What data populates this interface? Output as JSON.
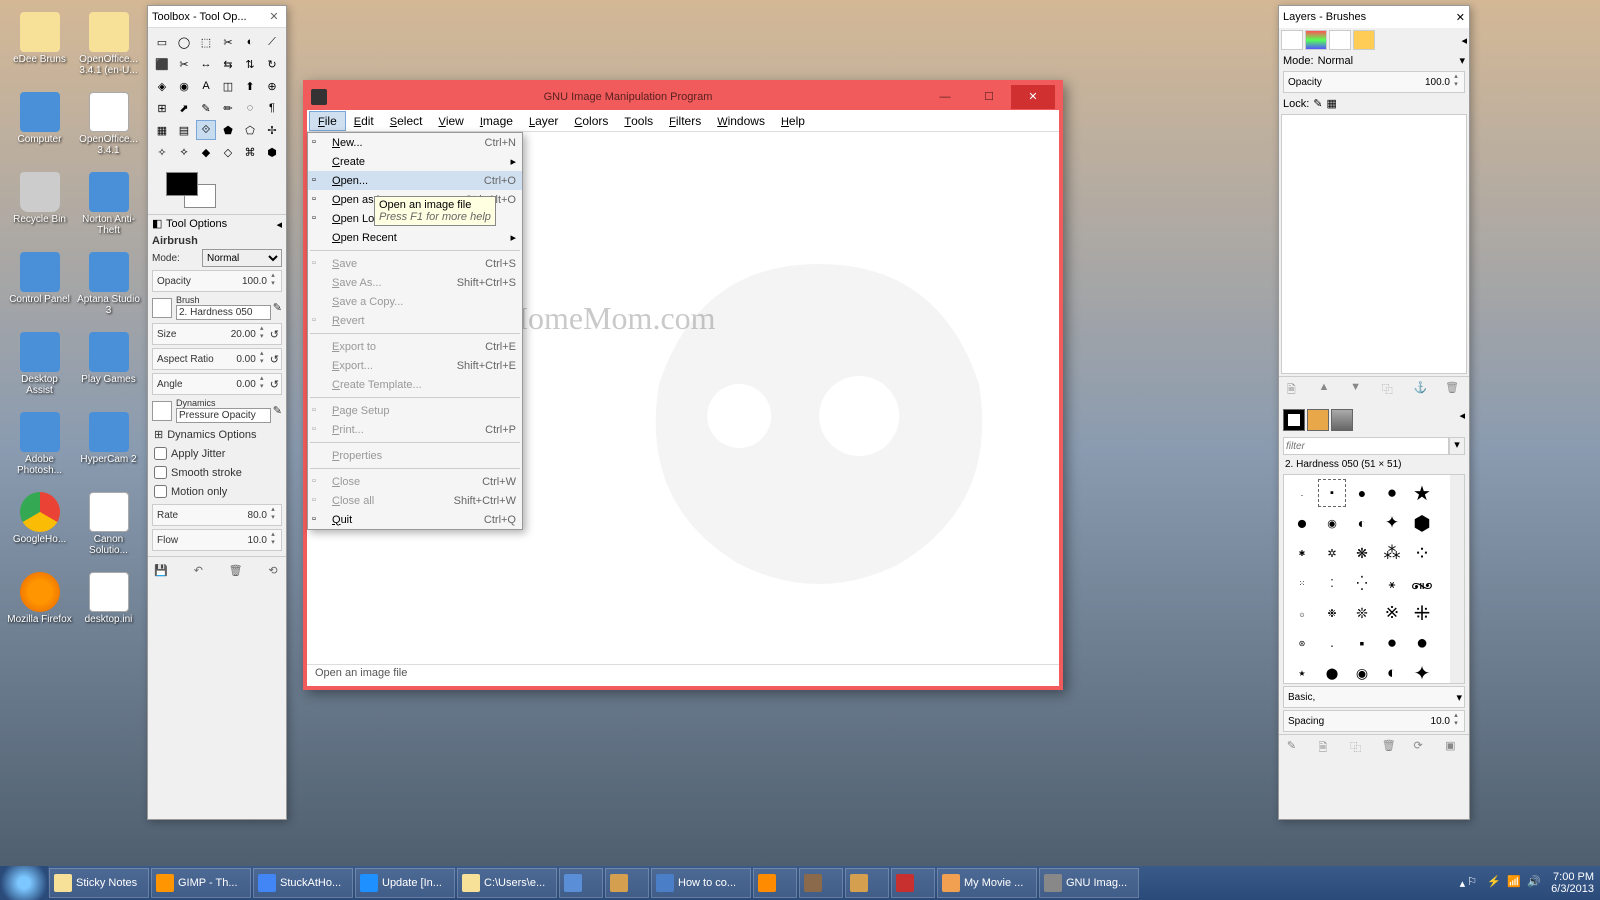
{
  "desktop_icons": [
    {
      "label": "eDee Bruns",
      "type": "folder"
    },
    {
      "label": "OpenOffice... 3.4.1 (en-U...",
      "type": "folder"
    },
    {
      "label": "Computer",
      "type": "app"
    },
    {
      "label": "OpenOffice... 3.4.1",
      "type": "doc"
    },
    {
      "label": "Recycle Bin",
      "type": "bin"
    },
    {
      "label": "Norton Anti-Theft",
      "type": "app"
    },
    {
      "label": "Control Panel",
      "type": "app"
    },
    {
      "label": "Aptana Studio 3",
      "type": "app"
    },
    {
      "label": "Desktop Assist",
      "type": "app"
    },
    {
      "label": "Play Games",
      "type": "app"
    },
    {
      "label": "Adobe Photosh...",
      "type": "app"
    },
    {
      "label": "HyperCam 2",
      "type": "app"
    },
    {
      "label": "GoogleHo...",
      "type": "chrome"
    },
    {
      "label": "Canon Solutio...",
      "type": "doc"
    },
    {
      "label": "Mozilla Firefox",
      "type": "ff"
    },
    {
      "label": "desktop.ini",
      "type": "doc"
    }
  ],
  "toolbox": {
    "title": "Toolbox - Tool Op...",
    "tool_options_label": "Tool Options",
    "tool_name": "Airbrush",
    "mode_label": "Mode:",
    "mode_value": "Normal",
    "opacity_label": "Opacity",
    "opacity_value": "100.0",
    "brush_label": "Brush",
    "brush_value": "2. Hardness 050",
    "size_label": "Size",
    "size_value": "20.00",
    "aspect_label": "Aspect Ratio",
    "aspect_value": "0.00",
    "angle_label": "Angle",
    "angle_value": "0.00",
    "dynamics_label": "Dynamics",
    "dynamics_value": "Pressure Opacity",
    "dyn_options": "Dynamics Options",
    "jitter": "Apply Jitter",
    "smooth": "Smooth stroke",
    "motion": "Motion only",
    "rate_label": "Rate",
    "rate_value": "80.0",
    "flow_label": "Flow",
    "flow_value": "10.0"
  },
  "gimp": {
    "title": "GNU Image Manipulation Program",
    "menus": [
      "File",
      "Edit",
      "Select",
      "View",
      "Image",
      "Layer",
      "Colors",
      "Tools",
      "Filters",
      "Windows",
      "Help"
    ],
    "statusbar": "Open an image file",
    "file_menu": [
      {
        "label": "New...",
        "key": "Ctrl+N",
        "icon": "doc"
      },
      {
        "label": "Create",
        "sub": true
      },
      {
        "label": "Open...",
        "key": "Ctrl+O",
        "icon": "folder",
        "hover": true
      },
      {
        "label": "Open as Layers...",
        "key": "Ctrl+Alt+O",
        "icon": "layers"
      },
      {
        "label": "Open Location...",
        "icon": "globe"
      },
      {
        "label": "Open Recent",
        "sub": true
      },
      {
        "sep": true
      },
      {
        "label": "Save",
        "key": "Ctrl+S",
        "icon": "save",
        "dis": true
      },
      {
        "label": "Save As...",
        "key": "Shift+Ctrl+S",
        "dis": true
      },
      {
        "label": "Save a Copy...",
        "dis": true
      },
      {
        "label": "Revert",
        "icon": "revert",
        "dis": true
      },
      {
        "sep": true
      },
      {
        "label": "Export to",
        "key": "Ctrl+E",
        "dis": true
      },
      {
        "label": "Export...",
        "key": "Shift+Ctrl+E",
        "dis": true
      },
      {
        "label": "Create Template...",
        "dis": true
      },
      {
        "sep": true
      },
      {
        "label": "Page Setup",
        "icon": "page",
        "dis": true
      },
      {
        "label": "Print...",
        "key": "Ctrl+P",
        "icon": "print",
        "dis": true
      },
      {
        "sep": true
      },
      {
        "label": "Properties",
        "dis": true
      },
      {
        "sep": true
      },
      {
        "label": "Close",
        "key": "Ctrl+W",
        "icon": "close",
        "dis": true
      },
      {
        "label": "Close all",
        "key": "Shift+Ctrl+W",
        "icon": "close",
        "dis": true
      },
      {
        "label": "Quit",
        "key": "Ctrl+Q",
        "icon": "quit"
      }
    ],
    "tooltip_title": "Open an image file",
    "tooltip_help": "Press F1 for more help"
  },
  "layers": {
    "title": "Layers - Brushes",
    "mode_label": "Mode:",
    "mode_value": "Normal",
    "opacity_label": "Opacity",
    "opacity_value": "100.0",
    "lock_label": "Lock:",
    "filter_placeholder": "filter",
    "brush_label": "2. Hardness 050 (51 × 51)",
    "preset_label": "Basic,",
    "spacing_label": "Spacing",
    "spacing_value": "10.0"
  },
  "taskbar": {
    "buttons": [
      {
        "label": "Sticky Notes",
        "color": "#f7e199"
      },
      {
        "label": "GIMP - Th...",
        "color": "#ff9500"
      },
      {
        "label": "StuckAtHo...",
        "color": "#4285f4"
      },
      {
        "label": "Update [In...",
        "color": "#1e90ff"
      },
      {
        "label": "C:\\Users\\e...",
        "color": "#f7e199"
      },
      {
        "label": "",
        "color": "#5a8fd8"
      },
      {
        "label": "",
        "color": "#d4a050"
      },
      {
        "label": "How to co...",
        "color": "#4a7fc8"
      },
      {
        "label": "",
        "color": "#ff8c00"
      },
      {
        "label": "",
        "color": "#8a6a4a"
      },
      {
        "label": "",
        "color": "#d4a050"
      },
      {
        "label": "",
        "color": "#c83030"
      },
      {
        "label": "My Movie ...",
        "color": "#f0a050"
      },
      {
        "label": "GNU Imag...",
        "color": "#888"
      }
    ],
    "time": "7:00 PM",
    "date": "6/3/2013"
  },
  "watermark": "StuckAtHomeMom.com"
}
